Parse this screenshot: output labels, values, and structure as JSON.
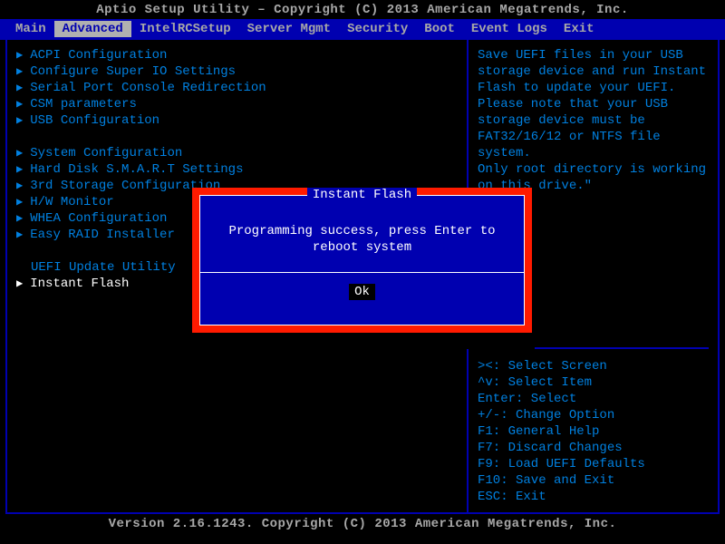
{
  "header": "Aptio Setup Utility – Copyright (C) 2013 American Megatrends, Inc.",
  "footer": "Version 2.16.1243. Copyright (C) 2013 American Megatrends, Inc.",
  "tabs": [
    "Main",
    "Advanced",
    "IntelRCSetup",
    "Server Mgmt",
    "Security",
    "Boot",
    "Event Logs",
    "Exit"
  ],
  "tabs_selected_index": 1,
  "menu_group1": [
    "ACPI Configuration",
    "Configure Super IO Settings",
    "Serial Port Console Redirection",
    "CSM parameters",
    "USB Configuration"
  ],
  "menu_group2": [
    "System Configuration",
    "Hard Disk S.M.A.R.T Settings",
    "3rd Storage Configuration",
    "H/W Monitor",
    "WHEA Configuration",
    "Easy RAID Installer"
  ],
  "menu_heading": "UEFI Update Utility",
  "menu_selected": "Instant Flash",
  "help_text": "Save UEFI files in your USB storage device and run Instant Flash to update your UEFI. Please note that your USB storage device must be FAT32/16/12 or NTFS file system.\nOnly root directory is working on this drive.\"",
  "hints": "><: Select Screen\n^v: Select Item\nEnter: Select\n+/-: Change Option\nF1: General Help\nF7: Discard Changes\nF9: Load UEFI Defaults\nF10: Save and Exit\nESC: Exit",
  "dialog": {
    "title": "Instant Flash",
    "body_l1": "Programming success, press Enter to",
    "body_l2": "reboot system",
    "ok": "Ok"
  }
}
